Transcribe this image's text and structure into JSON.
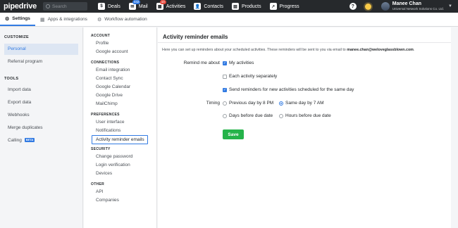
{
  "topbar": {
    "logo": "pipedrive",
    "search_placeholder": "Search",
    "nav": [
      {
        "label": "Deals",
        "icon": "$",
        "badge": ""
      },
      {
        "label": "Mail",
        "icon": "✉",
        "badge": "442"
      },
      {
        "label": "Activities",
        "icon": "▦",
        "badge": "10"
      },
      {
        "label": "Contacts",
        "icon": "👤",
        "badge": ""
      },
      {
        "label": "Products",
        "icon": "▤",
        "badge": ""
      },
      {
        "label": "Progress",
        "icon": "↗",
        "badge": ""
      }
    ],
    "help": "?",
    "user_name": "Manee Chan",
    "user_company": "Universal Network Solutions Co. Ltd."
  },
  "tabs": [
    {
      "label": "Settings",
      "icon": "⚙"
    },
    {
      "label": "Apps & integrations",
      "icon": "▦"
    },
    {
      "label": "Workflow automation",
      "icon": "⚙"
    }
  ],
  "left": {
    "customize_head": "CUSTOMIZE",
    "personal": "Personal",
    "referral": "Referral program",
    "tools_head": "TOOLS",
    "import": "Import data",
    "export": "Export data",
    "webhooks": "Webhooks",
    "merge": "Merge duplicates",
    "calling": "Calling",
    "beta": "BETA"
  },
  "mid": {
    "account_head": "ACCOUNT",
    "account": [
      "Profile",
      "Google account"
    ],
    "connections_head": "CONNECTIONS",
    "connections": [
      "Email integration",
      "Contact Sync",
      "Google Calendar",
      "Google Drive",
      "MailChimp"
    ],
    "preferences_head": "PREFERENCES",
    "preferences": [
      "User interface",
      "Notifications",
      "Activity reminder emails"
    ],
    "security_head": "SECURITY",
    "security": [
      "Change password",
      "Login verification",
      "Devices"
    ],
    "other_head": "OTHER",
    "other": [
      "API",
      "Companies"
    ]
  },
  "content": {
    "title": "Activity reminder emails",
    "desc_pre": "Here you can set up reminders about your scheduled activities. These reminders will be sent to you via email to ",
    "desc_email": "manee.chan@weloveglassblown.com",
    "desc_post": ".",
    "remind_label": "Remind me about",
    "opt_my_activities": "My activities",
    "opt_each_activity": "Each activity separately",
    "opt_new_activities": "Send reminders for new activities scheduled for the same day",
    "timing_label": "Timing",
    "opt_prev_day": "Previous day by 8 PM",
    "opt_same_day": "Same day by 7 AM",
    "opt_days_before": "Days before due date",
    "opt_hours_before": "Hours before due date",
    "save": "Save"
  }
}
